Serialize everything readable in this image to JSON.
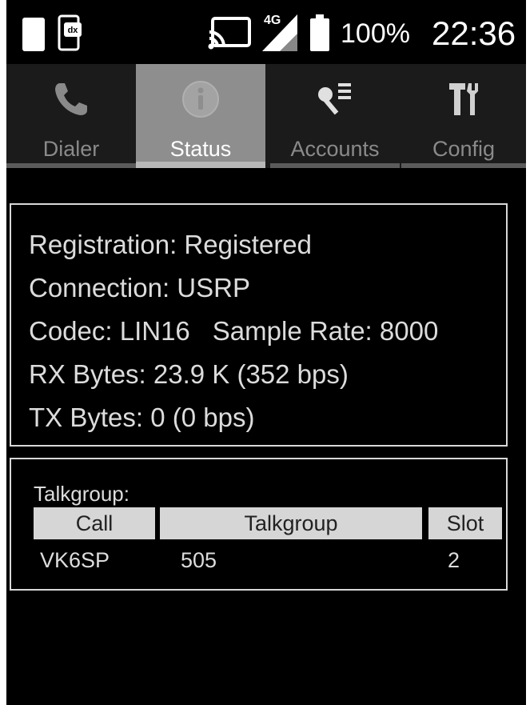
{
  "status_bar": {
    "icons": [
      "sd-card-icon",
      "radio-app-icon",
      "cast-icon",
      "signal-icon",
      "battery-icon"
    ],
    "network": "4G",
    "radio_badge": "dx",
    "battery_percent": "100%",
    "time": "22:36"
  },
  "tabs": [
    {
      "label": "Dialer",
      "icon": "phone-icon",
      "active": false
    },
    {
      "label": "Status",
      "icon": "info-icon",
      "active": true
    },
    {
      "label": "Accounts",
      "icon": "key-list-icon",
      "active": false
    },
    {
      "label": "Config",
      "icon": "tools-icon",
      "active": false
    }
  ],
  "status": {
    "registration": "Registration: Registered",
    "connection": "Connection: USRP",
    "codec": "Codec: LIN16",
    "sample_rate": "Sample Rate: 8000",
    "rx_bytes": "RX Bytes: 23.9 K (352 bps)",
    "tx_bytes": "TX Bytes: 0 (0 bps)"
  },
  "talkgroup": {
    "title": "Talkgroup:",
    "columns": [
      "Call",
      "Talkgroup",
      "Slot"
    ],
    "rows": [
      {
        "call": "VK6SP",
        "talkgroup": "505",
        "slot": "2"
      }
    ]
  }
}
